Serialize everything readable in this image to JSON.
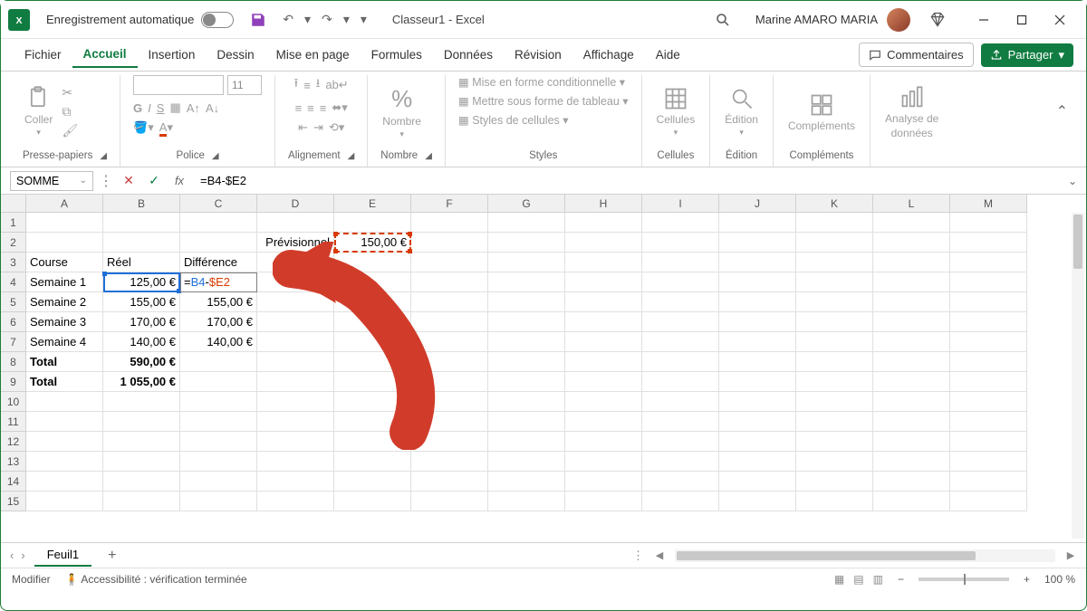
{
  "titlebar": {
    "autosave_label": "Enregistrement automatique",
    "document_title": "Classeur1 - Excel",
    "user_name": "Marine AMARO MARIA"
  },
  "tabs": {
    "fichier": "Fichier",
    "accueil": "Accueil",
    "insertion": "Insertion",
    "dessin": "Dessin",
    "mise_en_page": "Mise en page",
    "formules": "Formules",
    "donnees": "Données",
    "revision": "Révision",
    "affichage": "Affichage",
    "aide": "Aide",
    "commentaires": "Commentaires",
    "partager": "Partager"
  },
  "ribbon": {
    "clipboard": {
      "paste": "Coller",
      "group": "Presse-papiers"
    },
    "font": {
      "name_placeholder": "",
      "size_placeholder": "11",
      "bold": "G",
      "italic": "I",
      "underline": "S",
      "group": "Police"
    },
    "alignment": {
      "group": "Alignement"
    },
    "number": {
      "label": "Nombre",
      "group": "Nombre"
    },
    "styles": {
      "cond_format": "Mise en forme conditionnelle",
      "as_table": "Mettre sous forme de tableau",
      "cell_styles": "Styles de cellules",
      "group": "Styles"
    },
    "cells": {
      "label": "Cellules",
      "group": "Cellules"
    },
    "editing": {
      "label": "Édition",
      "group": "Édition"
    },
    "addins": {
      "label": "Compléments",
      "group": "Compléments"
    },
    "analysis": {
      "label1": "Analyse de",
      "label2": "données"
    }
  },
  "formula_bar": {
    "name_box": "SOMME",
    "formula": "=B4-$E2"
  },
  "columns": [
    "A",
    "B",
    "C",
    "D",
    "E",
    "F",
    "G",
    "H",
    "I",
    "J",
    "K",
    "L",
    "M"
  ],
  "rows": [
    "1",
    "2",
    "3",
    "4",
    "5",
    "6",
    "7",
    "8",
    "9",
    "10",
    "11",
    "12",
    "13",
    "14",
    "15"
  ],
  "cells": {
    "D2": "Prévisionnel",
    "E2": "150,00 €",
    "A3": "Course",
    "B3": "Réel",
    "C3": "Différence",
    "A4": "Semaine 1",
    "B4": "125,00 €",
    "C4_edit": {
      "eq": "=",
      "ref1": "B4",
      "op": "-",
      "ref2": "$E2"
    },
    "A5": "Semaine 2",
    "B5": "155,00 €",
    "C5": "155,00 €",
    "A6": "Semaine 3",
    "B6": "170,00 €",
    "C6": "170,00 €",
    "A7": "Semaine 4",
    "B7": "140,00 €",
    "C7": "140,00 €",
    "A8": "Total",
    "B8": "590,00 €",
    "A9": "Total",
    "B9": "1 055,00 €"
  },
  "sheet": {
    "name": "Feuil1"
  },
  "statusbar": {
    "mode": "Modifier",
    "accessibility": "Accessibilité : vérification terminée",
    "zoom_label": "100 %"
  }
}
